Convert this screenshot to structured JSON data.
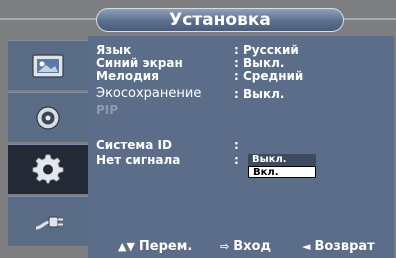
{
  "title": "Установка",
  "menu": [
    {
      "label": "Язык",
      "value": ": Русский",
      "style": "bold"
    },
    {
      "label": "Синий экран",
      "value": ": Выкл.",
      "style": "bold"
    },
    {
      "label": "Мелодия",
      "value": ": Средний",
      "style": "bold"
    },
    {
      "label": "Экосохранение",
      "value": ": Выкл.",
      "style": "thin"
    },
    {
      "label": "PIP",
      "value": "",
      "style": "dim"
    },
    {
      "label": "Система ID",
      "value": ":",
      "style": "bold"
    },
    {
      "label": "Нет сигнала",
      "value": ":",
      "style": "bold"
    }
  ],
  "dropdown": {
    "options": [
      "Выкл.",
      "Вкл."
    ],
    "selected": "Вкл."
  },
  "sidebar": [
    {
      "icon": "picture-icon"
    },
    {
      "icon": "sound-icon"
    },
    {
      "icon": "setup-gear-icon",
      "active": true
    },
    {
      "icon": "input-plug-icon"
    }
  ],
  "footer": {
    "move": "Перем.",
    "enter": "Вход",
    "back": "Возврат"
  }
}
